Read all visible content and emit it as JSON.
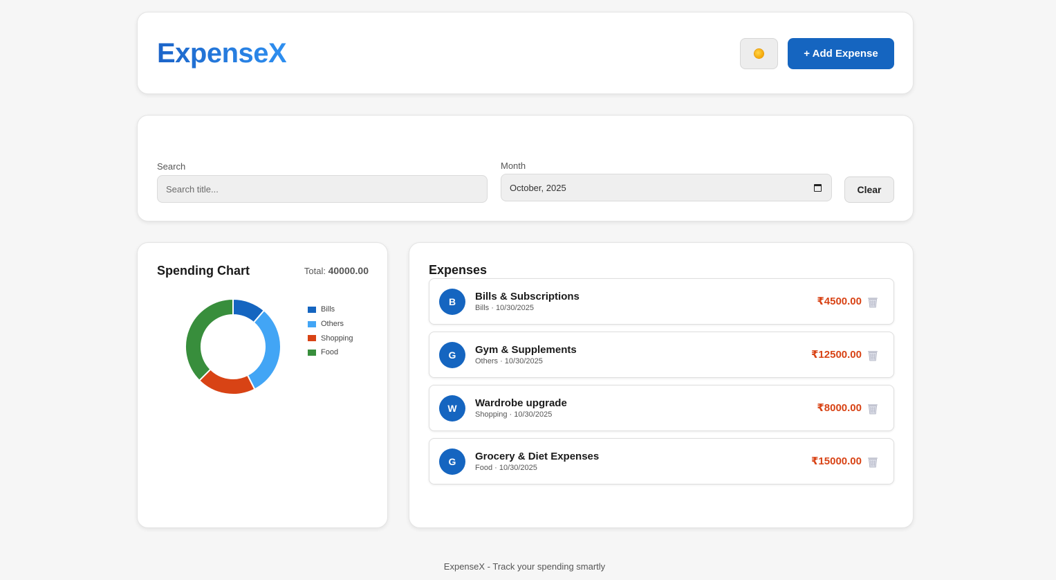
{
  "header": {
    "brand": "ExpenseX",
    "theme_icon": "sun-icon",
    "add_button": "+ Add Expense"
  },
  "filters": {
    "search_label": "Search",
    "search_placeholder": "Search title...",
    "month_label": "Month",
    "month_value": "October, 2025",
    "calendar_icon": "calendar-icon",
    "clear_button": "Clear"
  },
  "chart_panel": {
    "title": "Spending Chart",
    "total_label": "Total:",
    "total_value": "40000.00"
  },
  "chart_data": {
    "type": "pie",
    "donut": true,
    "categories": [
      "Bills",
      "Others",
      "Shopping",
      "Food"
    ],
    "values": [
      4500,
      12500,
      8000,
      15000
    ],
    "colors": [
      "#1565c0",
      "#42a5f5",
      "#d84315",
      "#388e3c"
    ],
    "legend_position": "right"
  },
  "expenses": {
    "title": "Expenses",
    "items": [
      {
        "initial": "B",
        "title": "Bills & Subscriptions",
        "meta": "Bills · 10/30/2025",
        "amount": "₹4500.00"
      },
      {
        "initial": "G",
        "title": "Gym & Supplements",
        "meta": "Others · 10/30/2025",
        "amount": "₹12500.00"
      },
      {
        "initial": "W",
        "title": "Wardrobe upgrade",
        "meta": "Shopping · 10/30/2025",
        "amount": "₹8000.00"
      },
      {
        "initial": "G",
        "title": "Grocery & Diet Expenses",
        "meta": "Food · 10/30/2025",
        "amount": "₹15000.00"
      }
    ],
    "delete_icon": "trash-icon"
  },
  "footer": {
    "text": "ExpenseX - Track your spending smartly"
  }
}
